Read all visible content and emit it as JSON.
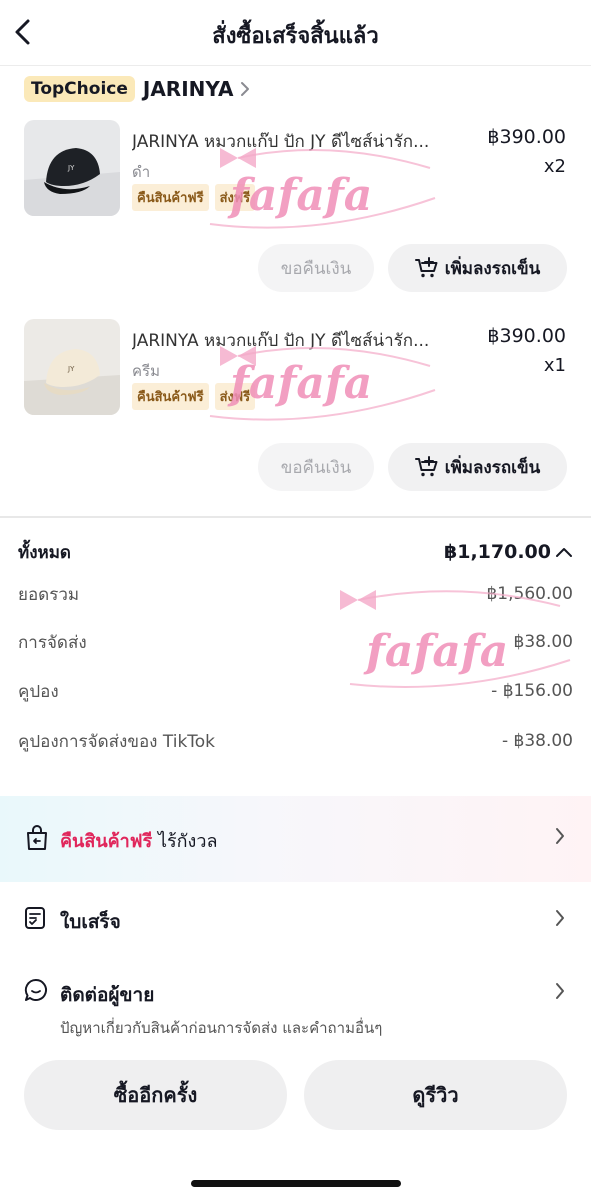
{
  "header": {
    "title": "สั่งซื้อเสร็จสิ้นแล้ว"
  },
  "shop": {
    "badge": "TopChoice",
    "name": "JARINYA"
  },
  "products": [
    {
      "title": "JARINYA หมวกแก๊ป ปัก JY ดีไซส์น่ารัก...",
      "variant": "ดำ",
      "badges": [
        "คืนสินค้าฟรี",
        "ส่งฟรี"
      ],
      "price": "฿390.00",
      "qty": "x2",
      "refund_label": "ขอคืนเงิน",
      "cart_label": "เพิ่มลงรถเข็น"
    },
    {
      "title": "JARINYA หมวกแก๊ป ปัก JY ดีไซส์น่ารัก...",
      "variant": "ครีม",
      "badges": [
        "คืนสินค้าฟรี",
        "ส่งฟรี"
      ],
      "price": "฿390.00",
      "qty": "x1",
      "refund_label": "ขอคืนเงิน",
      "cart_label": "เพิ่มลงรถเข็น"
    }
  ],
  "summary": {
    "total_label": "ทั้งหมด",
    "total_value": "฿1,170.00",
    "rows": [
      {
        "label": "ยอดรวม",
        "value": "฿1,560.00"
      },
      {
        "label": "การจัดส่ง",
        "value": "฿38.00"
      },
      {
        "label": "คูปอง",
        "value": "- ฿156.00"
      },
      {
        "label": "คูปองการจัดส่งของ TikTok",
        "value": "- ฿38.00"
      }
    ]
  },
  "promo": {
    "highlight": "คืนสินค้าฟรี",
    "text": "ไร้กังวล"
  },
  "receipt": {
    "label": "ใบเสร็จ"
  },
  "contact": {
    "label": "ติดต่อผู้ขาย",
    "sub": "ปัญหาเกี่ยวกับสินค้าก่อนการจัดส่ง และคำถามอื่นๆ"
  },
  "actions": {
    "buy_again": "ซื้ออีกครั้ง",
    "review": "ดูรีวิว"
  },
  "watermark": {
    "text": "fafafa"
  },
  "colors": {
    "accent_pink": "#e0265b",
    "badge_bg": "#fbeed7",
    "topchoice_bg": "#fbe9b9",
    "watermark": "#f08fb8"
  },
  "icons": [
    "back-arrow-icon",
    "chevron-right-icon",
    "cart-add-icon",
    "return-bag-icon",
    "receipt-icon",
    "chat-icon",
    "chevron-up-icon"
  ]
}
